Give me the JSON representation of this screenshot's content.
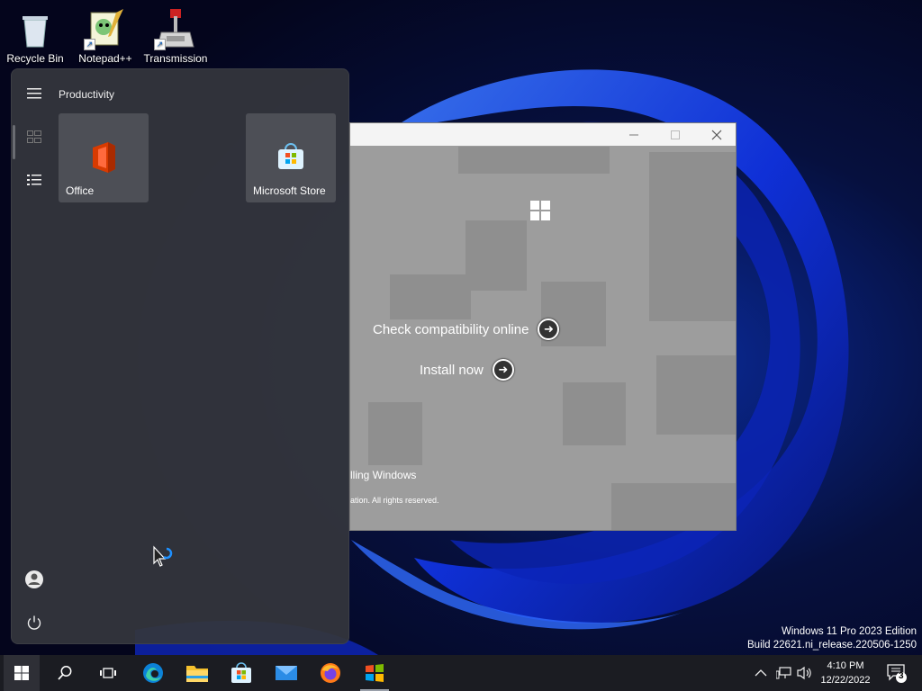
{
  "desktop": {
    "icons": [
      {
        "label": "Recycle Bin",
        "icon": "recycle-bin-icon"
      },
      {
        "label": "Notepad++",
        "icon": "notepad-plus-plus-icon"
      },
      {
        "label": "Transmission",
        "icon": "transmission-icon"
      }
    ]
  },
  "start_menu": {
    "group_title": "Productivity",
    "tiles": [
      {
        "label": "Office",
        "icon": "office-icon"
      },
      {
        "label": "Microsoft Store",
        "icon": "microsoft-store-icon"
      }
    ],
    "rail": [
      "hamburger-menu-icon",
      "pinned-tiles-icon",
      "all-apps-list-icon",
      "user-account-icon",
      "power-icon"
    ]
  },
  "setup_window": {
    "title": "",
    "check_compatibility_label": "Check compatibility online",
    "install_now_label": "Install now",
    "footer_text": "lling Windows",
    "copyright_text": "ation. All rights reserved."
  },
  "watermark": {
    "line1": "Windows 11 Pro 2023 Edition",
    "line2": "Build 22621.ni_release.220506-1250"
  },
  "taskbar": {
    "items": [
      "start-button",
      "search",
      "task-view",
      "microsoft-edge",
      "file-explorer",
      "microsoft-store",
      "mail",
      "firefox",
      "windows-setup"
    ],
    "clock_time": "4:10 PM",
    "clock_date": "12/22/2022",
    "notification_count": "3"
  },
  "colors": {
    "accent": "#1e3cff",
    "taskbar_bg": "#1b1c22",
    "start_menu_bg": "#34363c",
    "setup_bg": "#9d9d9d"
  }
}
